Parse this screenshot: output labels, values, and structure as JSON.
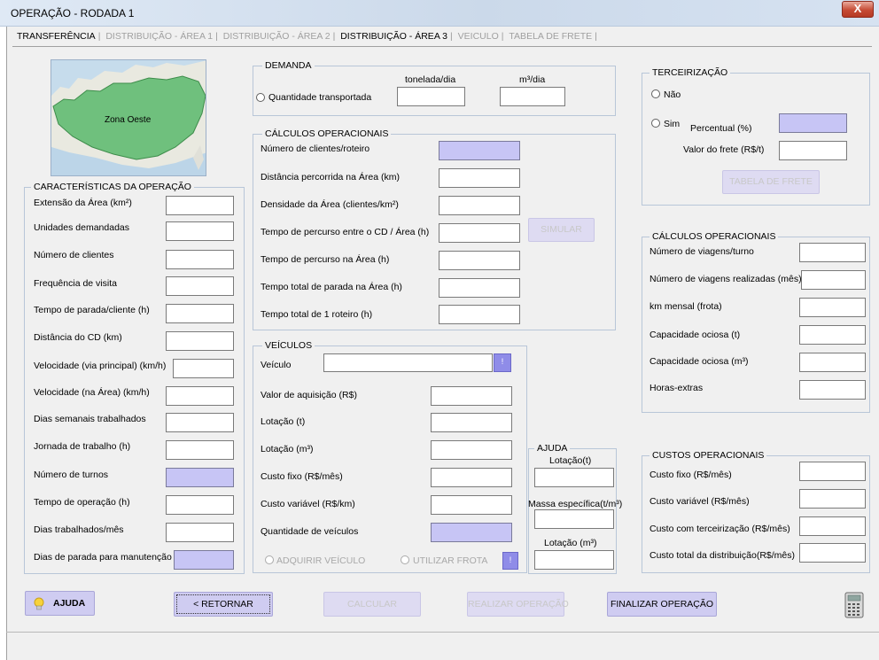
{
  "window": {
    "title": "OPERAÇÃO - RODADA 1",
    "close_label": "X"
  },
  "tabs": [
    {
      "label": "TRANSFERÊNCIA",
      "state": "active"
    },
    {
      "label": "DISTRIBUIÇÃO - ÁREA 1",
      "state": "disabled"
    },
    {
      "label": "DISTRIBUIÇÃO - ÁREA 2",
      "state": "disabled"
    },
    {
      "label": "DISTRIBUIÇÃO - ÁREA 3",
      "state": "active"
    },
    {
      "label": "VEICULO",
      "state": "disabled"
    },
    {
      "label": "TABELA DE FRETE",
      "state": "disabled"
    }
  ],
  "map": {
    "label": "Zona Oeste"
  },
  "caracteristicas": {
    "title": "CARACTERÍSTICAS DA OPERAÇÃO",
    "fields": [
      "Extensão da Área (km²)",
      "Unidades demandadas",
      "Número de clientes",
      "Frequência de visita",
      "Tempo de parada/cliente (h)",
      "Distância do CD (km)",
      "Velocidade (via principal) (km/h)",
      "Velocidade (na Área) (km/h)",
      "Dias semanais trabalhados",
      "Jornada de trabalho (h)",
      "Número de turnos",
      "Tempo de operação (h)",
      "Dias trabalhados/mês",
      "Dias de parada para manutenção"
    ]
  },
  "demanda": {
    "title": "DEMANDA",
    "col1": "tonelada/dia",
    "col2": "m³/dia",
    "radio_label": "Quantidade transportada"
  },
  "calc_op_center": {
    "title": "CÁLCULOS OPERACIONAIS",
    "fields": [
      "Número de clientes/roteiro",
      "Distância percorrida na Área (km)",
      "Densidade da Área (clientes/km²)",
      "Tempo de percurso entre o CD / Área (h)",
      "Tempo de percurso na Área  (h)",
      "Tempo total de parada na Área (h)",
      "Tempo total de 1 roteiro  (h)"
    ],
    "simular_label": "SIMULAR"
  },
  "veiculos": {
    "title": "VEÍCULOS",
    "veiculo_label": "Veículo",
    "dropdown_glyph": "!",
    "fields": [
      "Valor de aquisição (R$)",
      "Lotação (t)",
      "Lotação (m³)",
      "Custo fixo (R$/mês)",
      "Custo variável (R$/km)",
      "Quantidade de veículos"
    ],
    "radio_adquirir": "ADQUIRIR VEÍCULO",
    "radio_frota": "UTILIZAR FROTA",
    "frota_glyph": "!"
  },
  "ajuda_box": {
    "title": "AJUDA",
    "labels": [
      "Lotação(t)",
      "Massa específica(t/m³)",
      "Lotação (m³)"
    ]
  },
  "terceirizacao": {
    "title": "TERCEIRIZAÇÃO",
    "nao": "Não",
    "sim": "Sim",
    "percentual": "Percentual (%)",
    "valor_frete": "Valor do frete (R$/t)",
    "tabela_btn": "TABELA DE FRETE"
  },
  "calc_op_right": {
    "title": "CÁLCULOS OPERACIONAIS",
    "fields": [
      "Número de viagens/turno",
      "Número de viagens realizadas (mês)",
      "km mensal (frota)",
      "Capacidade ociosa (t)",
      "Capacidade ociosa (m³)",
      "Horas-extras"
    ]
  },
  "custos": {
    "title": "CUSTOS OPERACIONAIS",
    "fields": [
      "Custo fixo (R$/mês)",
      "Custo variável (R$/mês)",
      "Custo com terceirização (R$/mês)",
      "Custo total da distribuição(R$/mês)"
    ]
  },
  "buttons": {
    "ajuda": "AJUDA",
    "retornar": "< RETORNAR",
    "calcular": "CALCULAR",
    "realizar": "REALIZAR OPERAÇÃO",
    "finalizar": "FINALIZAR OPERAÇÃO"
  }
}
